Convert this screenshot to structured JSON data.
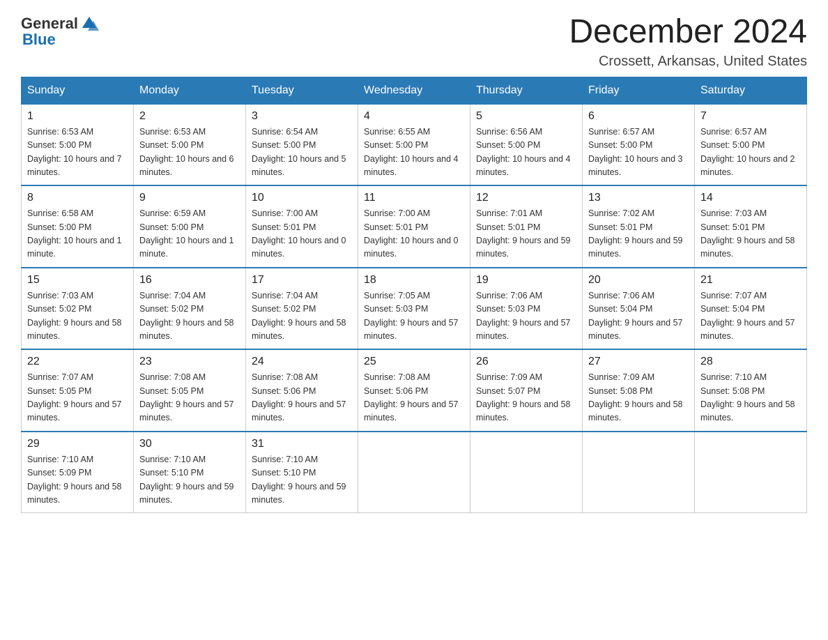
{
  "header": {
    "logo_general": "General",
    "logo_blue": "Blue",
    "month_title": "December 2024",
    "location": "Crossett, Arkansas, United States"
  },
  "days_of_week": [
    "Sunday",
    "Monday",
    "Tuesday",
    "Wednesday",
    "Thursday",
    "Friday",
    "Saturday"
  ],
  "weeks": [
    [
      {
        "day": "1",
        "sunrise": "6:53 AM",
        "sunset": "5:00 PM",
        "daylight": "10 hours and 7 minutes."
      },
      {
        "day": "2",
        "sunrise": "6:53 AM",
        "sunset": "5:00 PM",
        "daylight": "10 hours and 6 minutes."
      },
      {
        "day": "3",
        "sunrise": "6:54 AM",
        "sunset": "5:00 PM",
        "daylight": "10 hours and 5 minutes."
      },
      {
        "day": "4",
        "sunrise": "6:55 AM",
        "sunset": "5:00 PM",
        "daylight": "10 hours and 4 minutes."
      },
      {
        "day": "5",
        "sunrise": "6:56 AM",
        "sunset": "5:00 PM",
        "daylight": "10 hours and 4 minutes."
      },
      {
        "day": "6",
        "sunrise": "6:57 AM",
        "sunset": "5:00 PM",
        "daylight": "10 hours and 3 minutes."
      },
      {
        "day": "7",
        "sunrise": "6:57 AM",
        "sunset": "5:00 PM",
        "daylight": "10 hours and 2 minutes."
      }
    ],
    [
      {
        "day": "8",
        "sunrise": "6:58 AM",
        "sunset": "5:00 PM",
        "daylight": "10 hours and 1 minute."
      },
      {
        "day": "9",
        "sunrise": "6:59 AM",
        "sunset": "5:00 PM",
        "daylight": "10 hours and 1 minute."
      },
      {
        "day": "10",
        "sunrise": "7:00 AM",
        "sunset": "5:01 PM",
        "daylight": "10 hours and 0 minutes."
      },
      {
        "day": "11",
        "sunrise": "7:00 AM",
        "sunset": "5:01 PM",
        "daylight": "10 hours and 0 minutes."
      },
      {
        "day": "12",
        "sunrise": "7:01 AM",
        "sunset": "5:01 PM",
        "daylight": "9 hours and 59 minutes."
      },
      {
        "day": "13",
        "sunrise": "7:02 AM",
        "sunset": "5:01 PM",
        "daylight": "9 hours and 59 minutes."
      },
      {
        "day": "14",
        "sunrise": "7:03 AM",
        "sunset": "5:01 PM",
        "daylight": "9 hours and 58 minutes."
      }
    ],
    [
      {
        "day": "15",
        "sunrise": "7:03 AM",
        "sunset": "5:02 PM",
        "daylight": "9 hours and 58 minutes."
      },
      {
        "day": "16",
        "sunrise": "7:04 AM",
        "sunset": "5:02 PM",
        "daylight": "9 hours and 58 minutes."
      },
      {
        "day": "17",
        "sunrise": "7:04 AM",
        "sunset": "5:02 PM",
        "daylight": "9 hours and 58 minutes."
      },
      {
        "day": "18",
        "sunrise": "7:05 AM",
        "sunset": "5:03 PM",
        "daylight": "9 hours and 57 minutes."
      },
      {
        "day": "19",
        "sunrise": "7:06 AM",
        "sunset": "5:03 PM",
        "daylight": "9 hours and 57 minutes."
      },
      {
        "day": "20",
        "sunrise": "7:06 AM",
        "sunset": "5:04 PM",
        "daylight": "9 hours and 57 minutes."
      },
      {
        "day": "21",
        "sunrise": "7:07 AM",
        "sunset": "5:04 PM",
        "daylight": "9 hours and 57 minutes."
      }
    ],
    [
      {
        "day": "22",
        "sunrise": "7:07 AM",
        "sunset": "5:05 PM",
        "daylight": "9 hours and 57 minutes."
      },
      {
        "day": "23",
        "sunrise": "7:08 AM",
        "sunset": "5:05 PM",
        "daylight": "9 hours and 57 minutes."
      },
      {
        "day": "24",
        "sunrise": "7:08 AM",
        "sunset": "5:06 PM",
        "daylight": "9 hours and 57 minutes."
      },
      {
        "day": "25",
        "sunrise": "7:08 AM",
        "sunset": "5:06 PM",
        "daylight": "9 hours and 57 minutes."
      },
      {
        "day": "26",
        "sunrise": "7:09 AM",
        "sunset": "5:07 PM",
        "daylight": "9 hours and 58 minutes."
      },
      {
        "day": "27",
        "sunrise": "7:09 AM",
        "sunset": "5:08 PM",
        "daylight": "9 hours and 58 minutes."
      },
      {
        "day": "28",
        "sunrise": "7:10 AM",
        "sunset": "5:08 PM",
        "daylight": "9 hours and 58 minutes."
      }
    ],
    [
      {
        "day": "29",
        "sunrise": "7:10 AM",
        "sunset": "5:09 PM",
        "daylight": "9 hours and 58 minutes."
      },
      {
        "day": "30",
        "sunrise": "7:10 AM",
        "sunset": "5:10 PM",
        "daylight": "9 hours and 59 minutes."
      },
      {
        "day": "31",
        "sunrise": "7:10 AM",
        "sunset": "5:10 PM",
        "daylight": "9 hours and 59 minutes."
      },
      null,
      null,
      null,
      null
    ]
  ],
  "labels": {
    "sunrise": "Sunrise:",
    "sunset": "Sunset:",
    "daylight": "Daylight:"
  }
}
